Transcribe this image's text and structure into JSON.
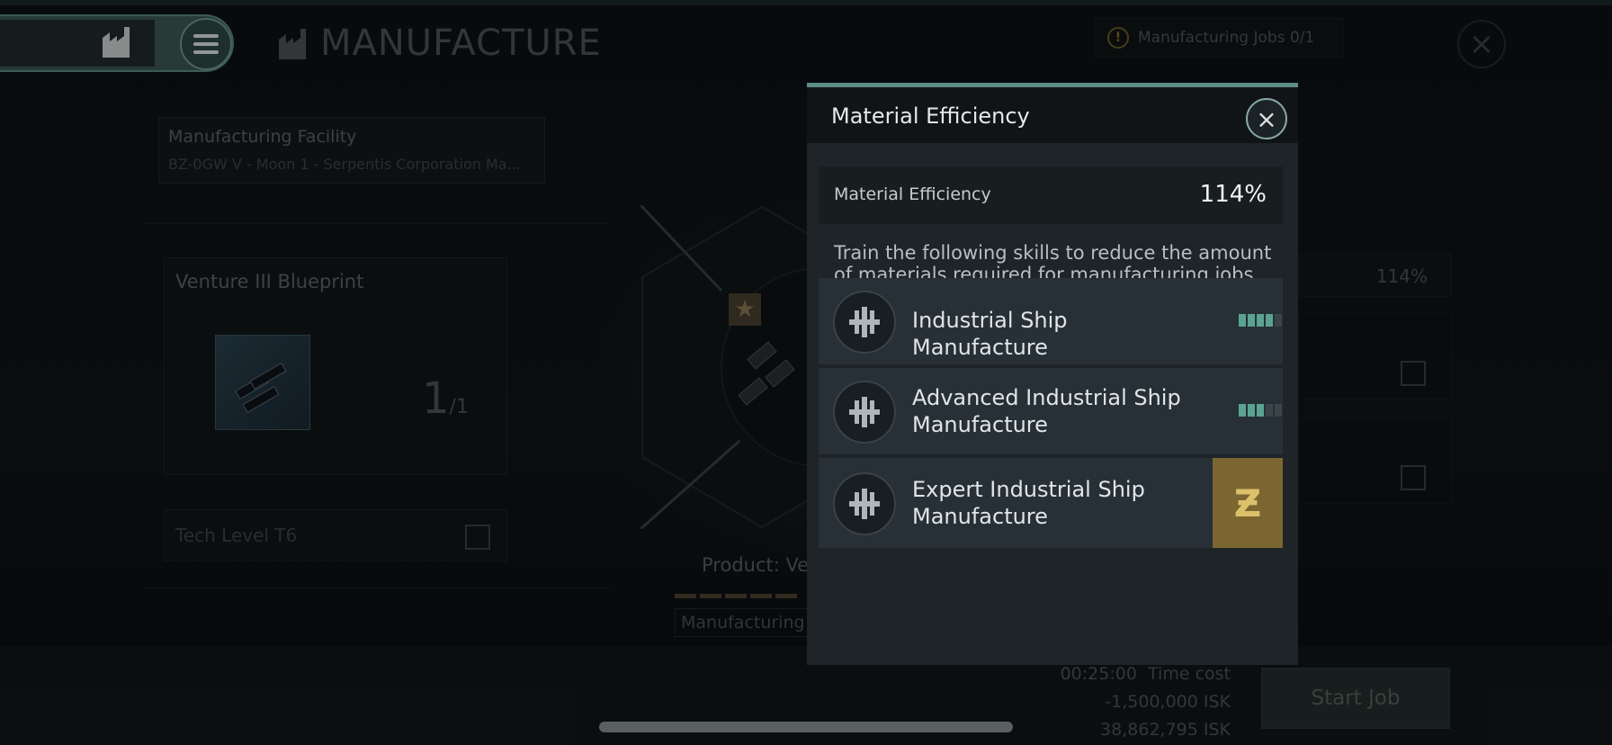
{
  "header": {
    "title": "MANUFACTURE",
    "jobs_text": "Manufacturing Jobs 0/1",
    "icons": [
      "factory-icon",
      "menu-icon",
      "warning-icon",
      "close-icon"
    ]
  },
  "facility": {
    "label": "Manufacturing Facility",
    "value": "BZ-0GW V - Moon 1 - Serpentis Corporation Ma..."
  },
  "blueprint": {
    "title": "Venture III Blueprint",
    "count": "1",
    "count_total": "/1"
  },
  "tech": {
    "label": "Tech Level T6"
  },
  "product": {
    "label": "Product: Ve",
    "tab_label": "Manufacturing"
  },
  "right_panel": {
    "material_efficiency": "114%"
  },
  "footer": {
    "time_cost_value": "00:25:00",
    "time_cost_label": "Time cost",
    "isk_cost": "-1,500,000 ISK",
    "isk_balance": "38,862,795 ISK",
    "start_button": "Start Job"
  },
  "modal": {
    "title": "Material Efficiency",
    "me_label": "Material Efficiency",
    "me_value": "114%",
    "description": "Train the following skills to reduce the amount of materials required for manufacturing jobs.",
    "skills": [
      {
        "name": "Industrial Ship Manufacture",
        "level": 4,
        "max": 5
      },
      {
        "name": "Advanced Industrial Ship Manufacture",
        "level": 3,
        "max": 5
      },
      {
        "name": "Expert Industrial Ship Manufacture",
        "locked_badge": "Ƶ"
      }
    ]
  },
  "colors": {
    "accent": "#5c8d86",
    "skill_level_on": "#5aa391",
    "omega_gold": "#7b6632"
  }
}
